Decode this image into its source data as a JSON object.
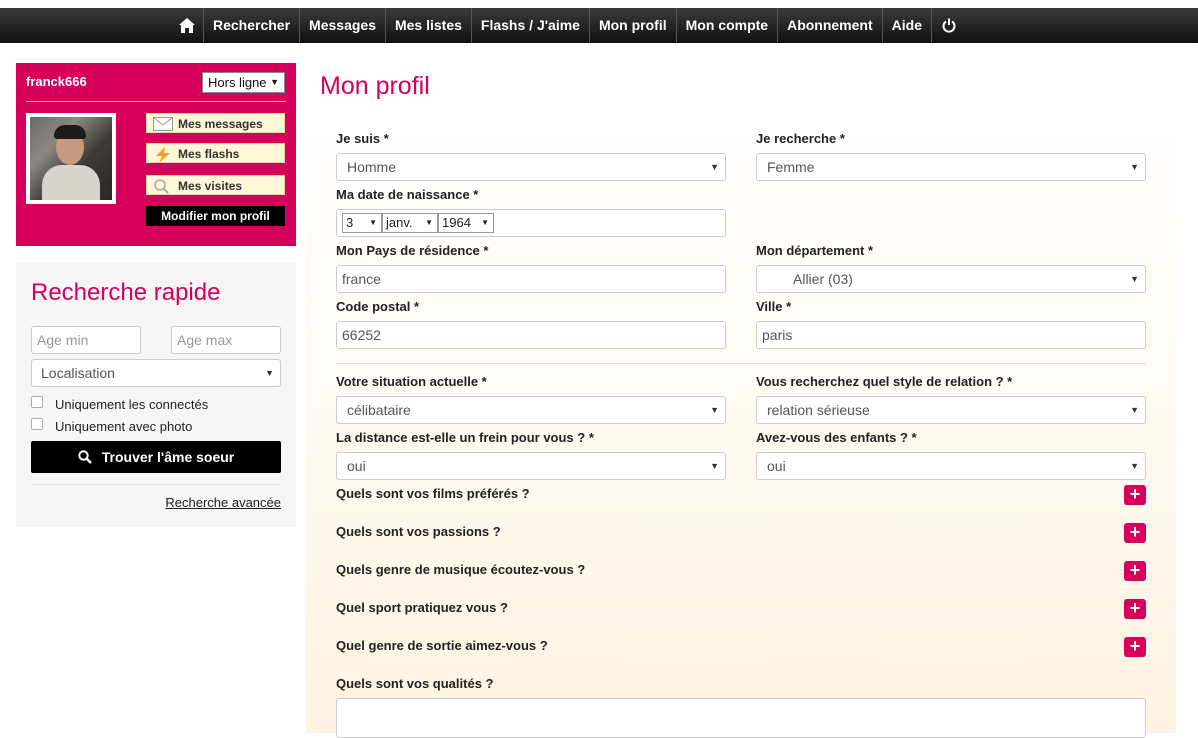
{
  "nav": {
    "items": [
      "Rechercher",
      "Messages",
      "Mes listes",
      "Flashs / J'aime",
      "Mon profil",
      "Mon compte",
      "Abonnement",
      "Aide"
    ]
  },
  "user": {
    "name": "franck666",
    "status": "Hors ligne",
    "btn_messages": "Mes messages",
    "btn_flashs": "Mes flashs",
    "btn_visites": "Mes visites",
    "btn_modifier": "Modifier mon profil"
  },
  "quick_search": {
    "title": "Recherche rapide",
    "age_min_placeholder": "Age min",
    "age_max_placeholder": "Age max",
    "location": "Localisation",
    "only_connected": "Uniquement les connectés",
    "only_photo": "Uniquement avec photo",
    "find_button": "Trouver l'âme soeur",
    "advanced": "Recherche avancée"
  },
  "profile": {
    "title": "Mon profil",
    "je_suis_label": "Je suis *",
    "je_suis_value": "Homme",
    "je_recherche_label": "Je recherche *",
    "je_recherche_value": "Femme",
    "dob_label": "Ma date de naissance *",
    "dob_day": "3",
    "dob_month": "janv.",
    "dob_year": "1964",
    "pays_label": "Mon Pays de résidence *",
    "pays_value": "france",
    "dept_label": "Mon département *",
    "dept_value": "Allier (03)",
    "cp_label": "Code postal *",
    "cp_value": "66252",
    "ville_label": "Ville *",
    "ville_value": "paris",
    "situation_label": "Votre situation actuelle *",
    "situation_value": "célibataire",
    "relation_label": "Vous recherchez quel style de relation ? *",
    "relation_value": "relation sérieuse",
    "distance_label": "La distance est-elle un frein pour vous ? *",
    "distance_value": "oui",
    "enfants_label": "Avez-vous des enfants ? *",
    "enfants_value": "oui",
    "q_films": "Quels sont vos films préférés ?",
    "q_passions": "Quels sont vos passions ?",
    "q_musique": "Quels genre de musique écoutez-vous ?",
    "q_sport": "Quel sport pratiquez vous ?",
    "q_sortie": "Quel genre de sortie aimez-vous ?",
    "q_qualites": "Quels sont vos qualités ?",
    "plus_symbol": "+"
  },
  "colors": {
    "accent": "#d6005b",
    "nav_bg": "#1a1a1a"
  }
}
